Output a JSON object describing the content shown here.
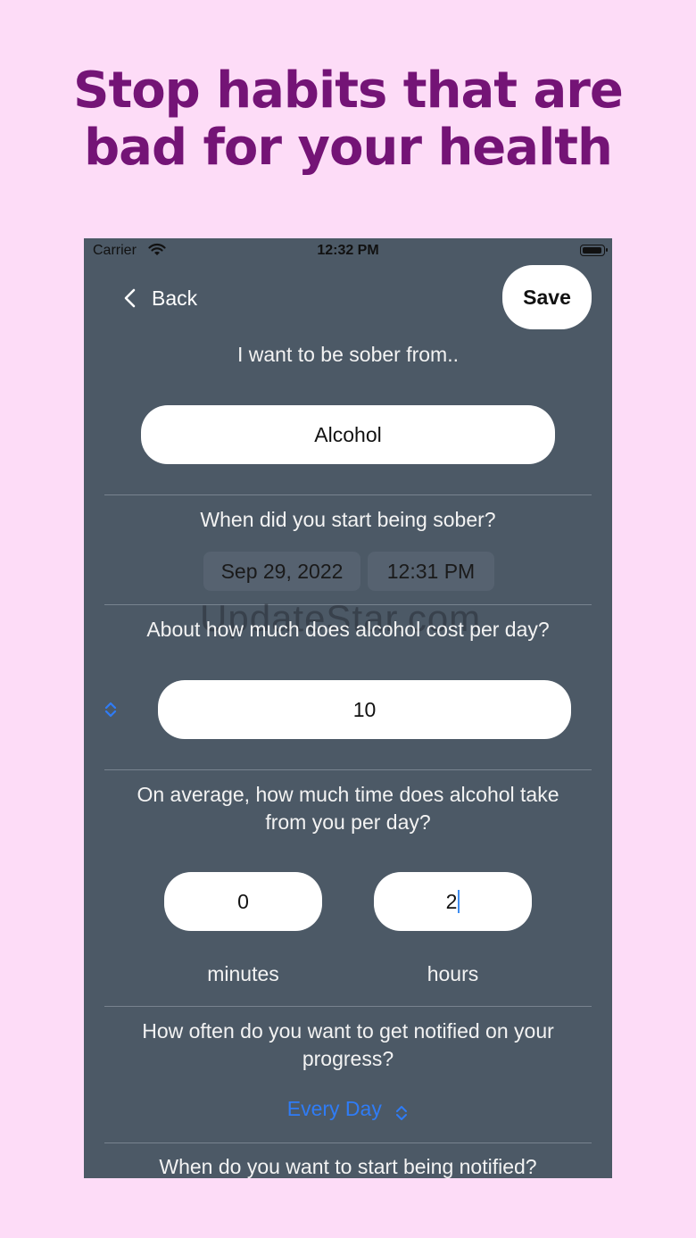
{
  "headline": {
    "line1": "Stop habits that are",
    "line2": "bad for your health"
  },
  "status_bar": {
    "carrier": "Carrier",
    "time": "12:32 PM"
  },
  "nav": {
    "back_label": "Back",
    "save_label": "Save"
  },
  "sober_from": {
    "label": "I want to be sober from..",
    "value": "Alcohol"
  },
  "start_date": {
    "label": "When did you start being sober?",
    "date": "Sep 29, 2022",
    "time": "12:31 PM"
  },
  "watermark": "UpdateStar.com",
  "cost": {
    "label": "About how much does alcohol cost per day?",
    "value": "10"
  },
  "time_taken": {
    "label": "On average, how much time does alcohol take from you per day?",
    "minutes_value": "0",
    "hours_value": "2",
    "minutes_label": "minutes",
    "hours_label": "hours"
  },
  "notification": {
    "label": "How often do you want to get notified on your progress?",
    "frequency": "Every Day",
    "start_label": "When do you want to start being notified?"
  },
  "colors": {
    "background": "#fddcf7",
    "headline": "#741476",
    "phone_bg": "#4c5966",
    "accent_blue": "#2f7cf6"
  }
}
